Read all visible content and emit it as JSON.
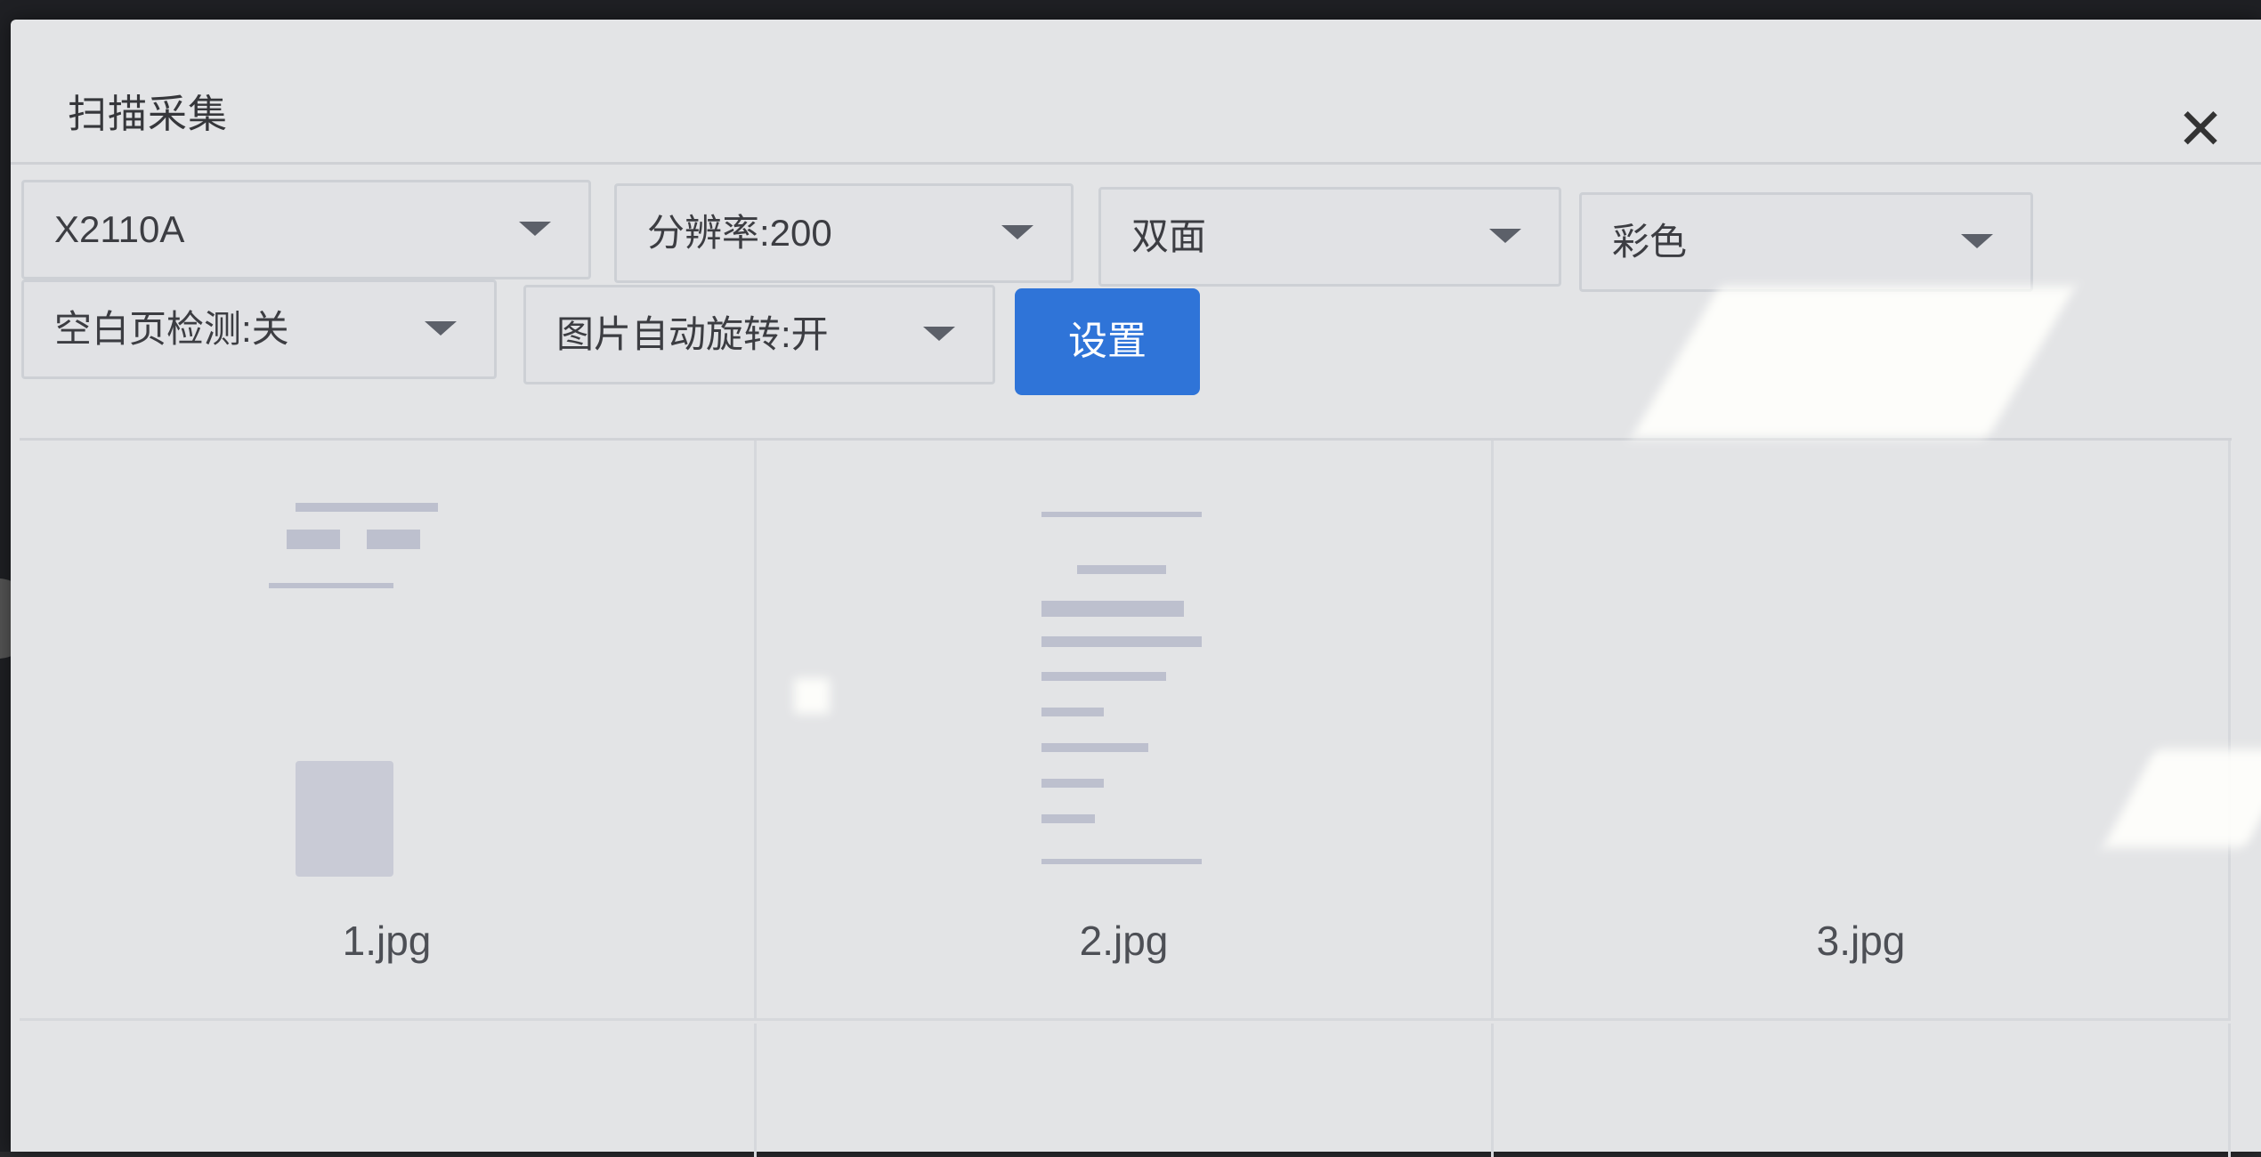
{
  "dialog": {
    "title": "扫描采集",
    "close_label": "✕"
  },
  "toolbar": {
    "scanner": "X2110A",
    "resolution": "分辨率:200",
    "duplex": "双面",
    "color_mode": "彩色",
    "blank_page_detect": "空白页检测:关",
    "auto_rotate": "图片自动旋转:开",
    "settings_button": "设置"
  },
  "images": [
    {
      "filename": "1.jpg"
    },
    {
      "filename": "2.jpg"
    },
    {
      "filename": "3.jpg"
    }
  ],
  "colors": {
    "accent": "#2f74d8",
    "dialog_bg": "#e3e4e6"
  }
}
